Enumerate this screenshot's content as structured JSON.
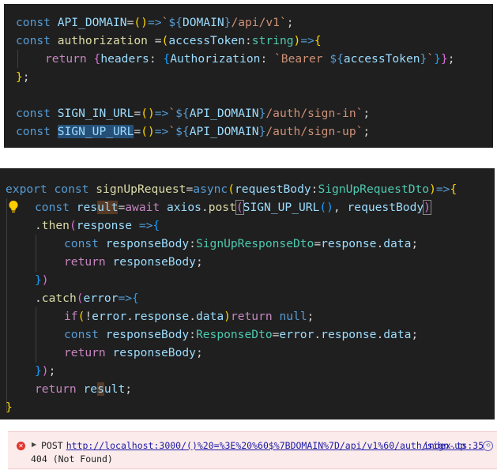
{
  "editor_top": {
    "line1": {
      "kw": "const",
      "name": "API_DOMAIN",
      "eq": "=",
      "p1": "()",
      "arrow": "=>",
      "tick1": "`",
      "open": "${",
      "var": "DOMAIN",
      "close": "}",
      "path": "/api/v1",
      "tick2": "`",
      "semi": ";"
    },
    "line2": {
      "kw": "const",
      "name": "authorization",
      "eq": " =",
      "p1": "(",
      "param": "accessToken",
      "colon": ":",
      "type": "string",
      "p2": ")",
      "arrow": "=>",
      "brace": "{"
    },
    "line3": {
      "kw": "return",
      "b1": "{",
      "prop": "headers",
      "colon": ": ",
      "b2": "{",
      "prop2": "Authorization",
      "colon2": ": ",
      "str": "`Bearer ",
      "open": "${",
      "var": "accessToken",
      "close": "}",
      "tick": "`",
      "b3": "}",
      "b4": "}",
      "semi": ";"
    },
    "line4": {
      "brace": "}",
      "semi": ";"
    },
    "line6": {
      "kw": "const",
      "name": "SIGN_IN_URL",
      "eq": "=",
      "p1": "()",
      "arrow": "=>",
      "tick1": "`",
      "open": "${",
      "var": "API_DOMAIN",
      "close": "}",
      "path": "/auth/sign-in",
      "tick2": "`",
      "semi": ";"
    },
    "line7": {
      "kw": "const",
      "name": "SIGN_UP_URL",
      "eq": "=",
      "p1": "()",
      "arrow": "=>",
      "tick1": "`",
      "open": "${",
      "var": "API_DOMAIN",
      "close": "}",
      "path": "/auth/sign-up",
      "tick2": "`",
      "semi": ";"
    }
  },
  "editor_bottom": {
    "line1": {
      "kw1": "export",
      "kw2": "const",
      "name": "signUpRequest",
      "eq": "=",
      "async": "async",
      "p1": "(",
      "param": "requestBody",
      "colon": ":",
      "type": "SignUpRequestDto",
      "p2": ")",
      "arrow": "=>",
      "brace": "{"
    },
    "line2": {
      "kw": "const",
      "name_a": "res",
      "name_b": "ult",
      "eq": "=",
      "await": "await",
      "obj": "axios",
      "dot": ".",
      "fn": "post",
      "p1": "(",
      "arg1a": "SIGN_UP",
      "arg1b": "_URL",
      "call": "()",
      "comma": ", ",
      "arg2": "requestBody",
      "p2": ")"
    },
    "line3": {
      "dot": ".",
      "fn": "then",
      "p1": "(",
      "param": "response",
      "arrow": " =>",
      "brace": "{"
    },
    "line4": {
      "kw": "const",
      "name": "responseBody",
      "colon": ":",
      "type": "SignUpResponseDto",
      "eq": "=",
      "obj": "response",
      "dot": ".",
      "prop": "data",
      "semi": ";"
    },
    "line5": {
      "kw": "return",
      "name": "responseBody",
      "semi": ";"
    },
    "line6": {
      "brace": "}",
      "paren": ")"
    },
    "line7": {
      "dot": ".",
      "fn": "catch",
      "p1": "(",
      "param": "error",
      "arrow": "=>",
      "brace": "{"
    },
    "line8": {
      "kw": "if",
      "p1": "(",
      "not": "!",
      "obj": "error",
      "d1": ".",
      "prop1": "response",
      "d2": ".",
      "prop2": "data",
      "p2": ")",
      "ret": "return",
      "nul": "null",
      "semi": ";"
    },
    "line9": {
      "kw": "const",
      "name": "responseBody",
      "colon": ":",
      "type": "ResponseDto",
      "eq": "=",
      "obj": "error",
      "d1": ".",
      "prop1": "response",
      "d2": ".",
      "prop2": "data",
      "semi": ";"
    },
    "line10": {
      "kw": "return",
      "name": "responseBody",
      "semi": ";"
    },
    "line11": {
      "brace": "}",
      "paren": ")",
      "semi": ";"
    },
    "line12": {
      "kw": "return",
      "name_a": "re",
      "name_b": "s",
      "name_c": "ult",
      "semi": ";"
    },
    "line13": {
      "brace": "}"
    }
  },
  "console": {
    "method": "POST",
    "url": "http://localhost:3000/()%20=%3E%20%60$%7BDOMAIN%7D/api/v1%60/auth/sign-up",
    "source": "index.ts:35",
    "status": "404 (Not Found)",
    "error_icon": "error-x-icon",
    "expand_icon": "expand-triangle-icon",
    "source_icon": "source-map-icon"
  }
}
